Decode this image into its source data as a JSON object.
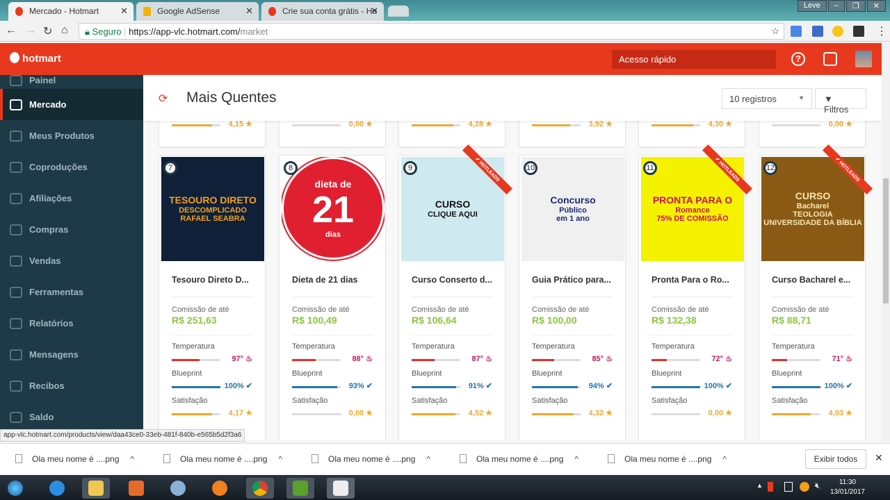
{
  "browser": {
    "tabs": [
      {
        "title": "Mercado - Hotmart",
        "active": true
      },
      {
        "title": "Google AdSense",
        "active": false
      },
      {
        "title": "Crie sua conta grátis - Ho",
        "active": false
      }
    ],
    "profile": "Leve",
    "secure_label": "Seguro",
    "url_scheme_host": "https://app-vlc.hotmart.com/",
    "url_path": "market",
    "status_url": "app-vlc.hotmart.com/products/view/daa43ce0-33eb-481f-840b-e565b5d2f3a6"
  },
  "header": {
    "logo": "hotmart",
    "quick_access": "Acesso rápido",
    "help": "?"
  },
  "sidebar": {
    "items": [
      {
        "label": "Painel"
      },
      {
        "label": "Mercado",
        "active": true
      },
      {
        "label": "Meus Produtos"
      },
      {
        "label": "Coproduções"
      },
      {
        "label": "Afiliações"
      },
      {
        "label": "Compras"
      },
      {
        "label": "Vendas"
      },
      {
        "label": "Ferramentas"
      },
      {
        "label": "Relatórios"
      },
      {
        "label": "Mensagens"
      },
      {
        "label": "Recibos"
      },
      {
        "label": "Saldo"
      }
    ]
  },
  "main": {
    "title": "Mais Quentes",
    "records_select": "10 registros",
    "filters_label": "Filtros",
    "commission_label": "Comissão de até",
    "temp_label": "Temperatura",
    "blueprint_label": "Blueprint",
    "satisfaction_label": "Satisfação",
    "hotleads_label": "✔ HOTLEADS",
    "prev_row_satisfaction": [
      "4,15",
      "0,00",
      "4,28",
      "3,92",
      "4,30",
      "0,00"
    ],
    "products": [
      {
        "rank": "7",
        "name": "Tesouro Direto D...",
        "commission": "R$ 251,63",
        "temp": "97°",
        "temp_pct": 97,
        "blueprint": "100%",
        "blueprint_pct": 100,
        "satisfaction": "4,17",
        "sat_value": 4.17,
        "hotleads": false,
        "img_lines": [
          "TESOURO DIRETO",
          "DESCOMPLICADO",
          "RAFAEL SEABRA"
        ],
        "img_bg": "#0f2038",
        "img_fg": "#f0a020"
      },
      {
        "rank": "8",
        "name": "Dieta de 21 dias",
        "commission": "R$ 100,49",
        "temp": "88°",
        "temp_pct": 88,
        "blueprint": "93%",
        "blueprint_pct": 93,
        "satisfaction": "0,00",
        "sat_value": 0,
        "hotleads": false,
        "img_lines": [
          "dieta de",
          "21",
          "dias"
        ],
        "img_bg": "#ffffff",
        "img_fg": "#ffffff"
      },
      {
        "rank": "9",
        "name": "Curso Conserto d...",
        "commission": "R$ 106,64",
        "temp": "87°",
        "temp_pct": 87,
        "blueprint": "91%",
        "blueprint_pct": 91,
        "satisfaction": "4,52",
        "sat_value": 4.52,
        "hotleads": true,
        "img_lines": [
          "CURSO",
          "CLIQUE AQUI"
        ],
        "img_bg": "#cfe9f0",
        "img_fg": "#111"
      },
      {
        "rank": "10",
        "name": "Guia Prático para...",
        "commission": "R$ 100,00",
        "temp": "85°",
        "temp_pct": 85,
        "blueprint": "94%",
        "blueprint_pct": 94,
        "satisfaction": "4,32",
        "sat_value": 4.32,
        "hotleads": false,
        "img_lines": [
          "Concurso",
          "Público",
          "em 1 ano"
        ],
        "img_bg": "#f0f0f0",
        "img_fg": "#1b2a7a"
      },
      {
        "rank": "11",
        "name": "Pronta Para o Ro...",
        "commission": "R$ 132,38",
        "temp": "72°",
        "temp_pct": 72,
        "blueprint": "100%",
        "blueprint_pct": 100,
        "satisfaction": "0,00",
        "sat_value": 0,
        "hotleads": true,
        "img_lines": [
          "PRONTA PARA O",
          "Romance",
          "75% DE COMISSÃO"
        ],
        "img_bg": "#f5f200",
        "img_fg": "#d0105a"
      },
      {
        "rank": "12",
        "name": "Curso Bacharel e...",
        "commission": "R$ 88,71",
        "temp": "71°",
        "temp_pct": 71,
        "blueprint": "100%",
        "blueprint_pct": 100,
        "satisfaction": "4,03",
        "sat_value": 4.03,
        "hotleads": true,
        "img_lines": [
          "CURSO",
          "Bacharel",
          "TEOLOGIA",
          "UNIVERSIDADE DA BÍBLIA"
        ],
        "img_bg": "#8a5a14",
        "img_fg": "#f5e6b0"
      }
    ]
  },
  "downloads": {
    "items": [
      "Ola meu nome é ....png",
      "Ola meu nome é ....png",
      "Ola meu nome é ....png",
      "Ola meu nome é ....png",
      "Ola meu nome é ....png"
    ],
    "show_all": "Exibir todos"
  },
  "taskbar": {
    "time": "11:30",
    "date": "13/01/2017"
  },
  "colors": {
    "brand": "#e8391f",
    "sidebar": "#1e3a46",
    "commission": "#8cc63f",
    "temp": "#d9322a",
    "blueprint": "#1d75b3",
    "satisfaction": "#f0a830",
    "temp_text": "#c2185b"
  }
}
